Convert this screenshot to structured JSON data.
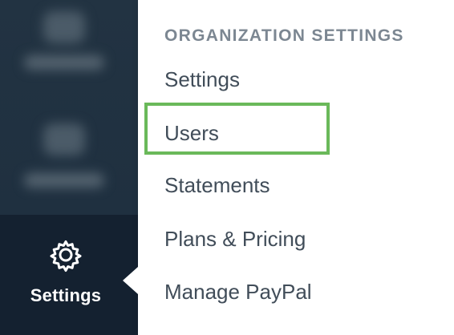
{
  "sidebar": {
    "active_item": {
      "label": "Settings",
      "icon": "gear-icon"
    }
  },
  "menu": {
    "section_header": "ORGANIZATION SETTINGS",
    "items": [
      {
        "label": "Settings"
      },
      {
        "label": "Users"
      },
      {
        "label": "Statements"
      },
      {
        "label": "Plans & Pricing"
      },
      {
        "label": "Manage PayPal"
      }
    ]
  },
  "highlight": {
    "target": "Users",
    "color": "#6ab95a"
  },
  "colors": {
    "sidebar": "#21313f",
    "sidebar_active": "#142130",
    "menu_text": "#414d59",
    "header_text": "#7c8792"
  }
}
